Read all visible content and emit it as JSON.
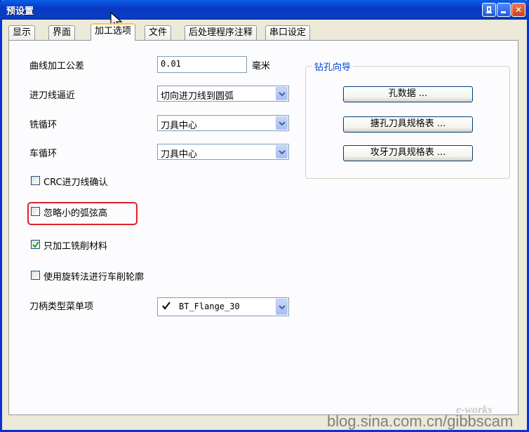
{
  "window": {
    "title": "预设置",
    "help_label": "",
    "minimize_label": "",
    "close_label": "✕"
  },
  "tabs": [
    {
      "label": "显示"
    },
    {
      "label": "界面"
    },
    {
      "label": "加工选项",
      "active": true
    },
    {
      "label": "文件"
    },
    {
      "label": "后处理程序注释"
    },
    {
      "label": "串口设定"
    }
  ],
  "form": {
    "curve_tolerance": {
      "label": "曲线加工公差",
      "value": "0.01",
      "unit": "毫米"
    },
    "lead_in": {
      "label": "进刀线逼近",
      "value": "切向进刀线到圆弧"
    },
    "mill_cycle": {
      "label": "铣循环",
      "value": "刀具中心"
    },
    "turn_cycle": {
      "label": "车循环",
      "value": "刀具中心"
    },
    "crc_confirm": {
      "label": "CRC进刀线确认",
      "checked": false
    },
    "ignore_small_arcs": {
      "label": "忽略小的弧弦高",
      "checked": false
    },
    "only_mill_material": {
      "label": "只加工铣削材料",
      "checked": true
    },
    "rotary_turn_profile": {
      "label": "使用旋转法进行车削轮廓",
      "checked": false
    },
    "holder_type": {
      "label": "刀柄类型菜单项",
      "value": "BT_Flange_30",
      "checked": true
    }
  },
  "drill_wizard": {
    "title": "钻孔向导",
    "buttons": [
      {
        "label": "孔数据 ..."
      },
      {
        "label": "搪孔刀具规格表 ..."
      },
      {
        "label": "攻牙刀具规格表 ..."
      }
    ]
  },
  "watermark": {
    "text": "blog.sina.com.cn/gibbscam",
    "brand": "e-works"
  },
  "colors": {
    "titlebar": "#0a3fbf",
    "accent": "#0046d5",
    "highlight": "#e0202a"
  }
}
